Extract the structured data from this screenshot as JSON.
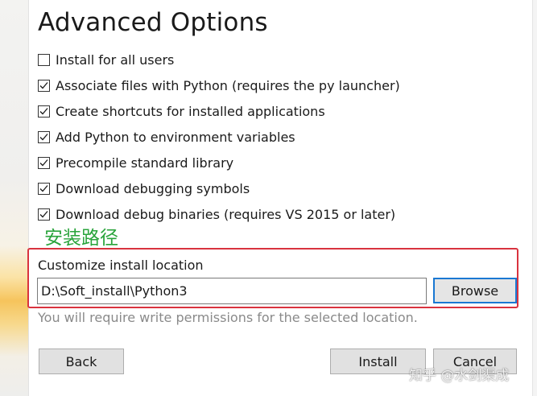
{
  "dialog": {
    "title": "Advanced Options"
  },
  "options": [
    {
      "label": "Install for all users",
      "checked": false
    },
    {
      "label": "Associate files with Python (requires the py launcher)",
      "checked": true
    },
    {
      "label": "Create shortcuts for installed applications",
      "checked": true
    },
    {
      "label": "Add Python to environment variables",
      "checked": true
    },
    {
      "label": "Precompile standard library",
      "checked": true
    },
    {
      "label": "Download debugging symbols",
      "checked": true
    },
    {
      "label": "Download debug binaries (requires VS 2015 or later)",
      "checked": true
    }
  ],
  "annotation": {
    "text": "安装路径",
    "color": "#2aa43c",
    "box_color": "#d9333f"
  },
  "location": {
    "label": "Customize install location",
    "value": "D:\\Soft_install\\Python3",
    "browse_label": "Browse",
    "note": "You will require write permissions for the selected location."
  },
  "buttons": {
    "back": "Back",
    "install": "Install",
    "cancel": "Cancel"
  },
  "watermark": {
    "text": "知乎 @水剑渠成"
  },
  "colors": {
    "accent": "#1a78d2",
    "text": "#1a1a1a",
    "muted": "#8a8a8a"
  }
}
